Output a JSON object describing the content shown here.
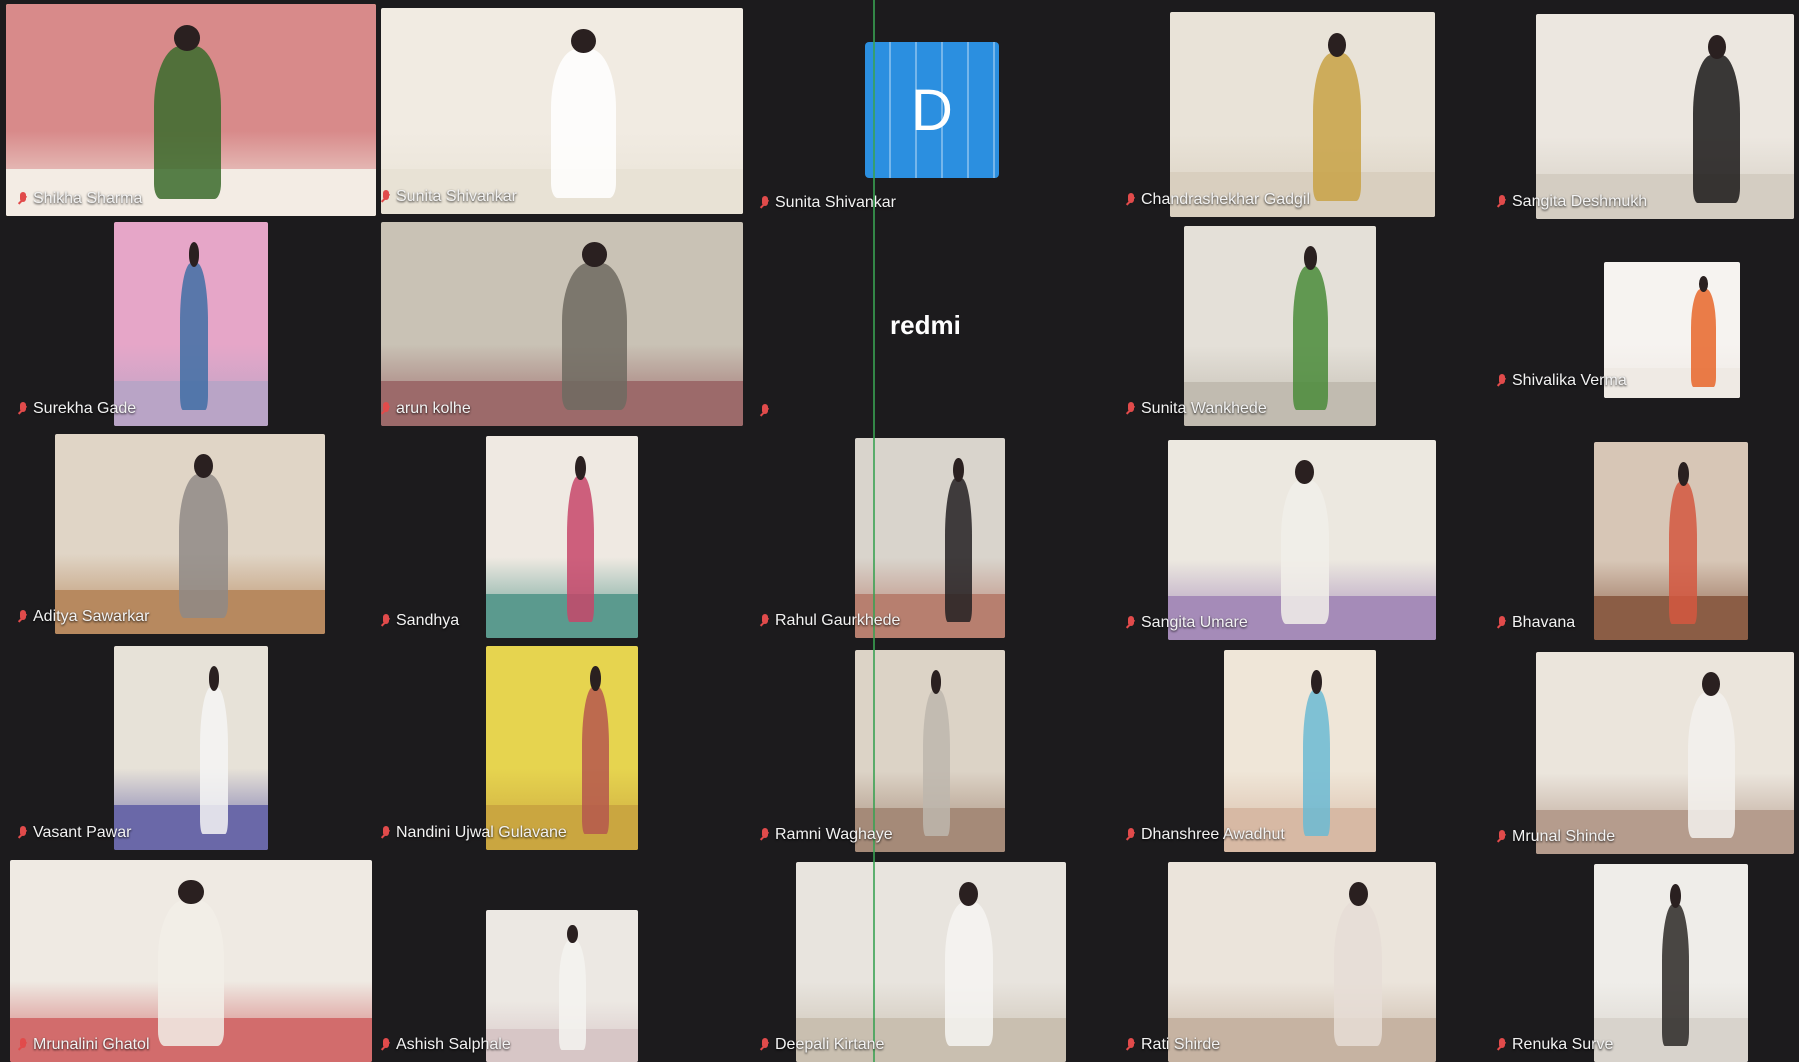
{
  "meeting": {
    "center_avatar_letter": "D",
    "center_label": "redmi",
    "center_name": "Sunita Shivankar"
  },
  "participants": [
    {
      "name": "Shikha Sharma",
      "active": true,
      "palette": [
        "#d88a8a",
        "#f3ece4",
        "#3a6b2c"
      ]
    },
    {
      "name": "Sunita Shivankar",
      "active": false,
      "palette": [
        "#f1ebe2",
        "#e8e2d5",
        "#ffffff"
      ]
    },
    {
      "name": "Chandrashekhar Gadgil",
      "active": false,
      "palette": [
        "#e9e3d8",
        "#d9cfbf",
        "#c8a245"
      ]
    },
    {
      "name": "Sangita Deshmukh",
      "active": false,
      "palette": [
        "#ece7e0",
        "#d4cdc2",
        "#1a1818"
      ]
    },
    {
      "name": "Surekha Gade",
      "active": false,
      "palette": [
        "#e6a6c8",
        "#b9a4c6",
        "#3f6fa4"
      ]
    },
    {
      "name": "arun kolhe",
      "active": false,
      "palette": [
        "#c9c2b5",
        "#9c6a6a",
        "#6e6a60"
      ]
    },
    {
      "name": "Sunita Wankhede",
      "active": false,
      "palette": [
        "#e4e0d8",
        "#c1bbb0",
        "#4a8b3a"
      ]
    },
    {
      "name": "Shivalika Verma",
      "active": false,
      "palette": [
        "#f6f3f0",
        "#efeae4",
        "#e8662a"
      ]
    },
    {
      "name": "Aditya Sawarkar",
      "active": false,
      "palette": [
        "#e0d5c6",
        "#b7895f",
        "#8f8a86"
      ]
    },
    {
      "name": "Sandhya",
      "active": false,
      "palette": [
        "#efe9e2",
        "#5b9a8e",
        "#c7466a"
      ]
    },
    {
      "name": "Rahul Gaurkhede",
      "active": false,
      "palette": [
        "#d9d4cc",
        "#b77f6f",
        "#232022"
      ]
    },
    {
      "name": "Sangita Umare",
      "active": false,
      "palette": [
        "#ece8e0",
        "#a58bb8",
        "#f1eee9"
      ]
    },
    {
      "name": "Bhavana",
      "active": false,
      "palette": [
        "#d7c6b6",
        "#8b5d45",
        "#d4573f"
      ]
    },
    {
      "name": "Vasant Pawar",
      "active": false,
      "palette": [
        "#e7e2d8",
        "#6a68a8",
        "#f4f4f4"
      ]
    },
    {
      "name": "Nandini Ujwal Gulavane",
      "active": false,
      "palette": [
        "#e6d44f",
        "#caa640",
        "#b5574e"
      ]
    },
    {
      "name": "Ramni Waghaye",
      "active": false,
      "palette": [
        "#dcd3c6",
        "#a58a78",
        "#bdb6ad"
      ]
    },
    {
      "name": "Dhanshree Awadhut",
      "active": false,
      "palette": [
        "#efe6d8",
        "#d7b9a4",
        "#6bbad4"
      ]
    },
    {
      "name": "Mrunal Shinde",
      "active": false,
      "palette": [
        "#ebe5dc",
        "#b59c8d",
        "#f3f1ed"
      ]
    },
    {
      "name": "Mrunalini Ghatol",
      "active": false,
      "palette": [
        "#efeae3",
        "#d26c6c",
        "#f2efe8"
      ]
    },
    {
      "name": "Ashish Salphale",
      "active": false,
      "palette": [
        "#ece8e3",
        "#d7c6c6",
        "#f5f3f0"
      ]
    },
    {
      "name": "Deepali Kirtane",
      "active": false,
      "palette": [
        "#e8e4de",
        "#c9bfb0",
        "#f6f5f2"
      ]
    },
    {
      "name": "Rati Shirde",
      "active": false,
      "palette": [
        "#ebe4db",
        "#c6b3a2",
        "#e6ddd6"
      ]
    },
    {
      "name": "Renuka Surve",
      "active": false,
      "palette": [
        "#efede9",
        "#d8d3cc",
        "#2c2826"
      ]
    }
  ]
}
